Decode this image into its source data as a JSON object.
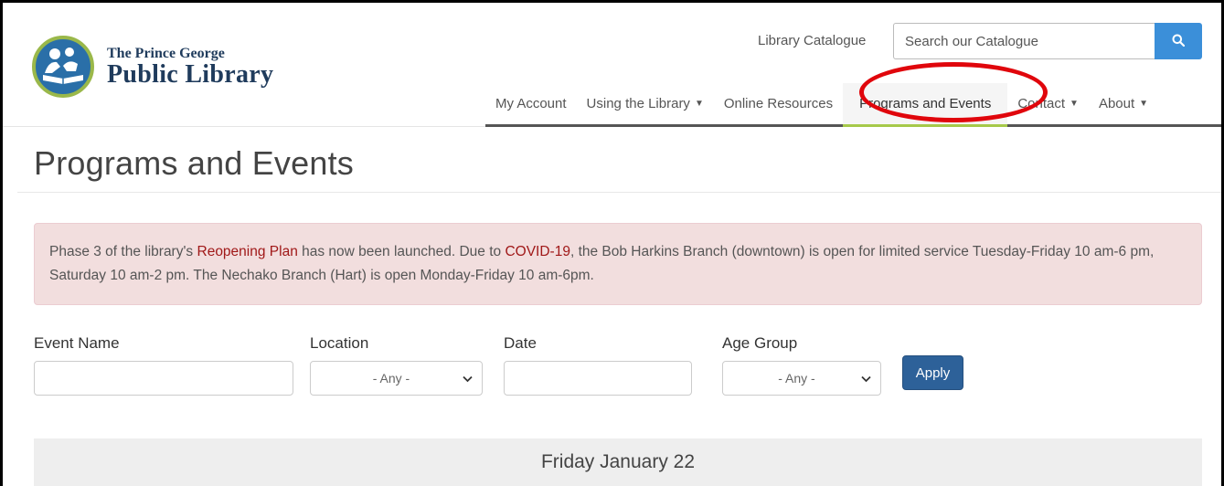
{
  "header": {
    "logo_small": "The Prince George",
    "logo_big": "Public Library",
    "catalogue_link": "Library Catalogue",
    "search_placeholder": "Search our Catalogue"
  },
  "nav": {
    "items": [
      {
        "label": "My Account",
        "dropdown": false
      },
      {
        "label": "Using the Library",
        "dropdown": true
      },
      {
        "label": "Online Resources",
        "dropdown": false
      },
      {
        "label": "Programs and Events",
        "dropdown": false,
        "active": true
      },
      {
        "label": "Contact",
        "dropdown": true
      },
      {
        "label": "About",
        "dropdown": true
      }
    ]
  },
  "page": {
    "title": "Programs and Events"
  },
  "alert": {
    "part1": "Phase 3 of the library's ",
    "link1": "Reopening Plan",
    "part2": " has now been launched. Due to ",
    "link2": "COVID-19",
    "part3": ", the Bob Harkins Branch (downtown) is open for limited service Tuesday-Friday 10 am-6 pm, Saturday 10 am-2 pm. The Nechako Branch (Hart) is open Monday-Friday 10 am-6pm."
  },
  "filters": {
    "event_name_label": "Event Name",
    "event_name_value": "",
    "location_label": "Location",
    "location_value": "- Any -",
    "date_label": "Date",
    "date_value": "",
    "age_group_label": "Age Group",
    "age_group_value": "- Any -",
    "apply_label": "Apply"
  },
  "date_heading": "Friday January 22",
  "colors": {
    "brand_navy": "#1f3b5c",
    "logo_blue": "#2a6fa8",
    "logo_green": "#9ab84a",
    "search_button": "#3b8fd9",
    "nav_active_underline": "#a6c94a",
    "alert_bg": "#f2dede",
    "alert_link": "#a01818",
    "apply_button": "#2d6199",
    "annotation_circle": "#e0060c"
  },
  "icons": {
    "search": "search-icon",
    "caret": "caret-down-icon",
    "chevron": "chevron-down-icon"
  }
}
